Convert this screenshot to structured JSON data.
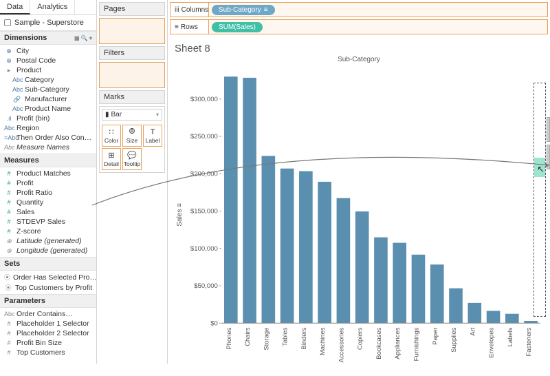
{
  "tabs": {
    "data": "Data",
    "analytics": "Analytics"
  },
  "datasource": "Sample - Superstore",
  "dimensions": {
    "title": "Dimensions",
    "items": [
      {
        "icon": "⊕",
        "label": "City",
        "cls": "blue"
      },
      {
        "icon": "⊕",
        "label": "Postal Code",
        "cls": "blue"
      },
      {
        "icon": "▸",
        "label": "Product",
        "cls": "gray",
        "triangle": true
      },
      {
        "icon": "Abc",
        "label": "Category",
        "cls": "blue",
        "indent": true
      },
      {
        "icon": "Abc",
        "label": "Sub-Category",
        "cls": "blue",
        "indent": true
      },
      {
        "icon": "🔗",
        "label": "Manufacturer",
        "cls": "gray",
        "indent": true
      },
      {
        "icon": "Abc",
        "label": "Product Name",
        "cls": "blue",
        "indent": true
      },
      {
        "icon": ".ıl",
        "label": "Profit (bin)",
        "cls": "blue"
      },
      {
        "icon": "Abc",
        "label": "Region",
        "cls": "blue"
      },
      {
        "icon": "=Abc",
        "label": "Then Order Also Con…",
        "cls": "blue"
      },
      {
        "icon": "Abc",
        "label": "Measure Names",
        "cls": "gray italic"
      }
    ]
  },
  "measures": {
    "title": "Measures",
    "items": [
      {
        "icon": "#",
        "label": "Product Matches",
        "cls": "teal"
      },
      {
        "icon": "#",
        "label": "Profit",
        "cls": "teal"
      },
      {
        "icon": "#",
        "label": "Profit Ratio",
        "cls": "teal"
      },
      {
        "icon": "#",
        "label": "Quantity",
        "cls": "teal"
      },
      {
        "icon": "#",
        "label": "Sales",
        "cls": "teal"
      },
      {
        "icon": "#",
        "label": "STDEVP Sales",
        "cls": "teal"
      },
      {
        "icon": "#",
        "label": "Z-score",
        "cls": "teal"
      },
      {
        "icon": "⊕",
        "label": "Latitude (generated)",
        "cls": "gray italic"
      },
      {
        "icon": "⊕",
        "label": "Longitude (generated)",
        "cls": "gray italic"
      }
    ]
  },
  "sets": {
    "title": "Sets",
    "items": [
      {
        "icon": "⦿",
        "label": "Order Has Selected Pro…",
        "cls": "gray"
      },
      {
        "icon": "⦿",
        "label": "Top Customers by Profit",
        "cls": "gray"
      }
    ]
  },
  "parameters": {
    "title": "Parameters",
    "items": [
      {
        "icon": "Abc",
        "label": "Order Contains…",
        "cls": "gray"
      },
      {
        "icon": "#",
        "label": "Placeholder 1 Selector",
        "cls": "gray"
      },
      {
        "icon": "#",
        "label": "Placeholder 2 Selector",
        "cls": "gray"
      },
      {
        "icon": "#",
        "label": "Profit Bin Size",
        "cls": "gray"
      },
      {
        "icon": "#",
        "label": "Top Customers",
        "cls": "gray"
      }
    ]
  },
  "cards": {
    "pages": "Pages",
    "filters": "Filters",
    "marks": "Marks"
  },
  "marks": {
    "type": "Bar",
    "buttons": [
      {
        "icon": "∷",
        "label": "Color"
      },
      {
        "icon": "⦾",
        "label": "Size"
      },
      {
        "icon": "T",
        "label": "Label"
      },
      {
        "icon": "⊞",
        "label": "Detail"
      },
      {
        "icon": "💬",
        "label": "Tooltip"
      }
    ]
  },
  "shelves": {
    "columns": {
      "label": "Columns",
      "pill": "Sub-Category"
    },
    "rows": {
      "label": "Rows",
      "pill": "SUM(Sales)"
    }
  },
  "sheet": {
    "title": "Sheet 8",
    "xtitle": "Sub-Category",
    "ytitle": "Sales"
  },
  "chart_data": {
    "type": "bar",
    "title": "Sub-Category",
    "xlabel": "Sub-Category",
    "ylabel": "Sales",
    "ylim": [
      0,
      340000
    ],
    "yticks": [
      0,
      50000,
      100000,
      150000,
      200000,
      250000,
      300000
    ],
    "yticklabels": [
      "$0",
      "$50,000",
      "$100,000",
      "$150,000",
      "$200,000",
      "$250,000",
      "$300,000"
    ],
    "categories": [
      "Phones",
      "Chairs",
      "Storage",
      "Tables",
      "Binders",
      "Machines",
      "Accessories",
      "Copiers",
      "Bookcases",
      "Appliances",
      "Furnishings",
      "Paper",
      "Supplies",
      "Art",
      "Envelopes",
      "Labels",
      "Fasteners"
    ],
    "values": [
      330007,
      328449,
      223844,
      206966,
      203413,
      189239,
      167380,
      149528,
      114880,
      107532,
      91705,
      78479,
      46674,
      27119,
      16476,
      12486,
      3024
    ]
  }
}
